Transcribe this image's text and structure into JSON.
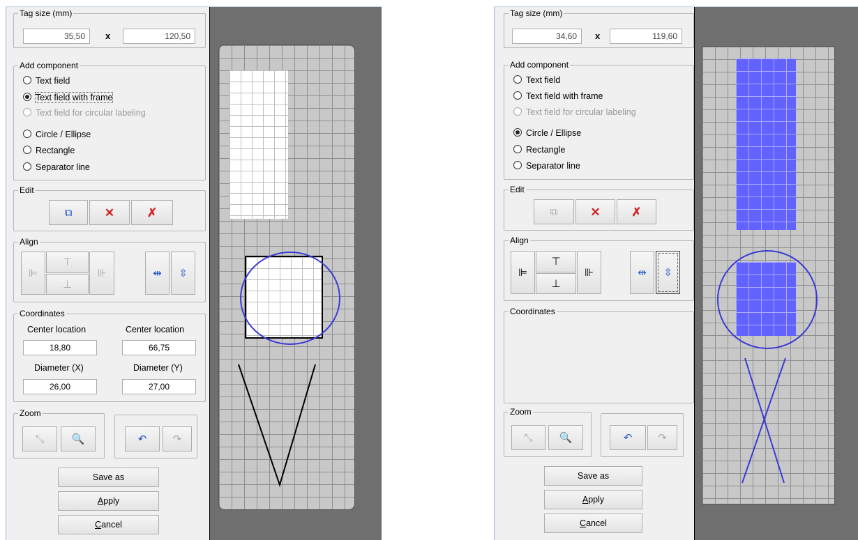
{
  "left": {
    "tag_size": {
      "legend": "Tag size (mm)",
      "width": "35,50",
      "x_label": "x",
      "height": "120,50"
    },
    "add_component": {
      "legend": "Add component",
      "options": [
        {
          "label": "Text field",
          "state": "off"
        },
        {
          "label": "Text field with frame",
          "state": "on"
        },
        {
          "label": "Text field for circular labeling",
          "state": "disabled"
        },
        {
          "label": "Circle  / Ellipse",
          "state": "off"
        },
        {
          "label": "Rectangle",
          "state": "off"
        },
        {
          "label": "Separator line",
          "state": "off"
        }
      ]
    },
    "edit": {
      "legend": "Edit"
    },
    "align": {
      "legend": "Align"
    },
    "coordinates": {
      "legend": "Coordinates",
      "center_x_label": "Center location",
      "center_x": "18,80",
      "center_y_label": "Center location",
      "center_y": "66,75",
      "diam_x_label": "Diameter (X)",
      "diam_x": "26,00",
      "diam_y_label": "Diameter (Y)",
      "diam_y": "27,00"
    },
    "zoom": {
      "legend": "Zoom"
    },
    "buttons": {
      "save_as": "Save as",
      "apply_first": "A",
      "apply_rest": "pply",
      "cancel_first": "C",
      "cancel_rest": "ancel"
    }
  },
  "right": {
    "tag_size": {
      "legend": "Tag size (mm)",
      "width": "34,60",
      "x_label": "x",
      "height": "119,60"
    },
    "add_component": {
      "legend": "Add component",
      "options": [
        {
          "label": "Text field",
          "state": "off"
        },
        {
          "label": "Text field with frame",
          "state": "off"
        },
        {
          "label": "Text field for circular labeling",
          "state": "disabled"
        },
        {
          "label": "Circle  / Ellipse",
          "state": "on"
        },
        {
          "label": "Rectangle",
          "state": "off"
        },
        {
          "label": "Separator line",
          "state": "off"
        }
      ]
    },
    "edit": {
      "legend": "Edit"
    },
    "align": {
      "legend": "Align"
    },
    "coordinates": {
      "legend": "Coordinates"
    },
    "zoom": {
      "legend": "Zoom"
    },
    "buttons": {
      "save_as": "Save as",
      "apply_first": "A",
      "apply_rest": "pply",
      "cancel_first": "C",
      "cancel_rest": "ancel"
    }
  },
  "colors": {
    "shape_blue": "#3a3ad6",
    "fill_blue": "#6262ff",
    "canvas_bg": "#6f6f6f",
    "grid_bg": "#c8c8c8"
  },
  "icons": [
    "copy-icon",
    "delete-icon",
    "delete-all-icon",
    "align-left-icon",
    "align-top-icon",
    "align-bottom-icon",
    "align-right-icon",
    "center-horizontal-icon",
    "center-vertical-icon",
    "zoom-fit-icon",
    "zoom-icon",
    "undo-icon",
    "redo-icon"
  ]
}
